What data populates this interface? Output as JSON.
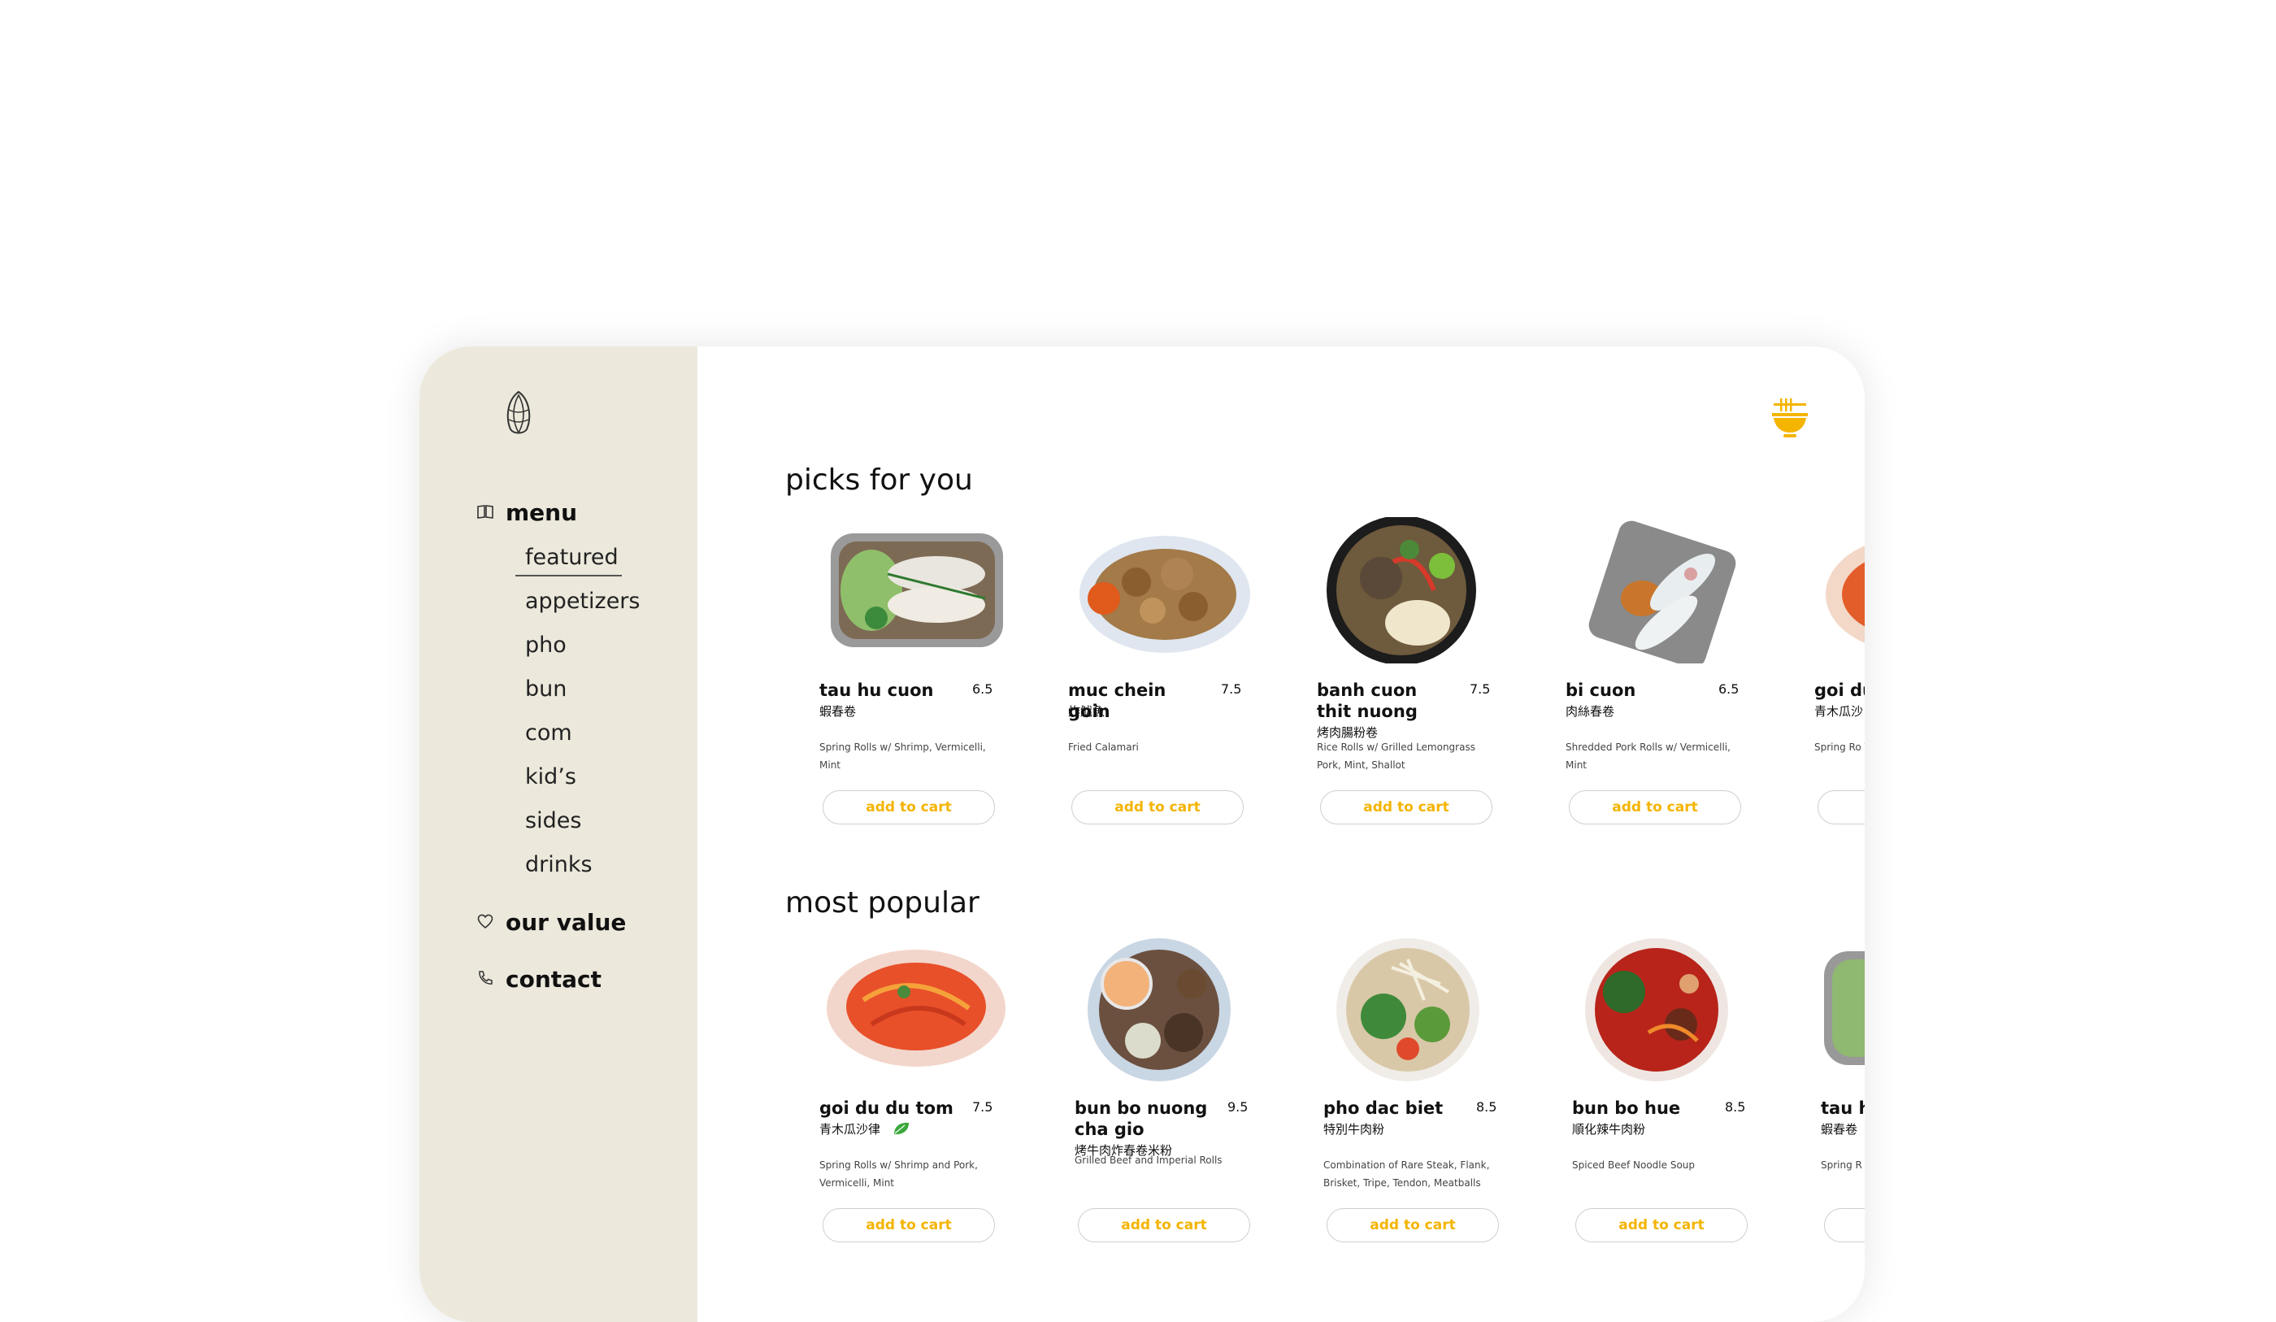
{
  "nav": {
    "menu_label": "menu",
    "sub_items": [
      "featured",
      "appetizers",
      "pho",
      "bun",
      "com",
      "kid’s",
      "sides",
      "drinks"
    ],
    "our_value_label": "our value",
    "contact_label": "contact"
  },
  "colors": {
    "sidebar": "#ece9dc",
    "accent": "#f4b400"
  },
  "sections": [
    {
      "title": "picks for you",
      "items": [
        {
          "name": "tau hu cuon",
          "price": "6.5",
          "cn": "蝦春卷",
          "desc": "Spring Rolls w/ Shrimp, Vermicelli, Mint",
          "button": "add to cart"
        },
        {
          "name": "muc chein goin",
          "price": "7.5",
          "cn": "炸魷魚",
          "desc": "Fried Calamari",
          "button": "add to cart"
        },
        {
          "name": "banh cuon thit nuong",
          "price": "7.5",
          "cn": "烤肉腸粉卷",
          "desc": "Rice Rolls w/ Grilled Lemongrass Pork, Mint, Shallot",
          "button": "add to cart"
        },
        {
          "name": "bi cuon",
          "price": "6.5",
          "cn": "肉絲春卷",
          "desc": "Shredded Pork Rolls w/ Vermicelli, Mint",
          "button": "add to cart"
        },
        {
          "name": "goi du",
          "price": "",
          "cn": "青木瓜沙",
          "desc": "Spring Ro Vermicelli",
          "button": ""
        }
      ]
    },
    {
      "title": "most popular",
      "items": [
        {
          "name": "goi du du tom",
          "price": "7.5",
          "cn": "青木瓜沙律",
          "desc": "Spring Rolls w/ Shrimp and Pork, Vermicelli, Mint",
          "button": "add to cart"
        },
        {
          "name": "bun bo nuong cha gio",
          "price": "9.5",
          "cn": "烤牛肉炸春卷米粉",
          "desc": "Grilled Beef and Imperial Rolls",
          "button": "add to cart"
        },
        {
          "name": "pho dac biet",
          "price": "8.5",
          "cn": "特別牛肉粉",
          "desc": "Combination of Rare Steak, Flank, Brisket, Tripe, Tendon, Meatballs",
          "button": "add to cart"
        },
        {
          "name": "bun bo hue",
          "price": "8.5",
          "cn": "順化辣牛肉粉",
          "desc": "Spiced Beef Noodle Soup",
          "button": "add to cart"
        },
        {
          "name": "tau h",
          "price": "",
          "cn": "蝦春卷",
          "desc": "Spring R Mint",
          "button": ""
        }
      ]
    }
  ],
  "icons": [
    "lotus-logo-icon",
    "book-icon",
    "heart-icon",
    "phone-icon",
    "noodle-bowl-cart-icon",
    "leaf-icon"
  ]
}
